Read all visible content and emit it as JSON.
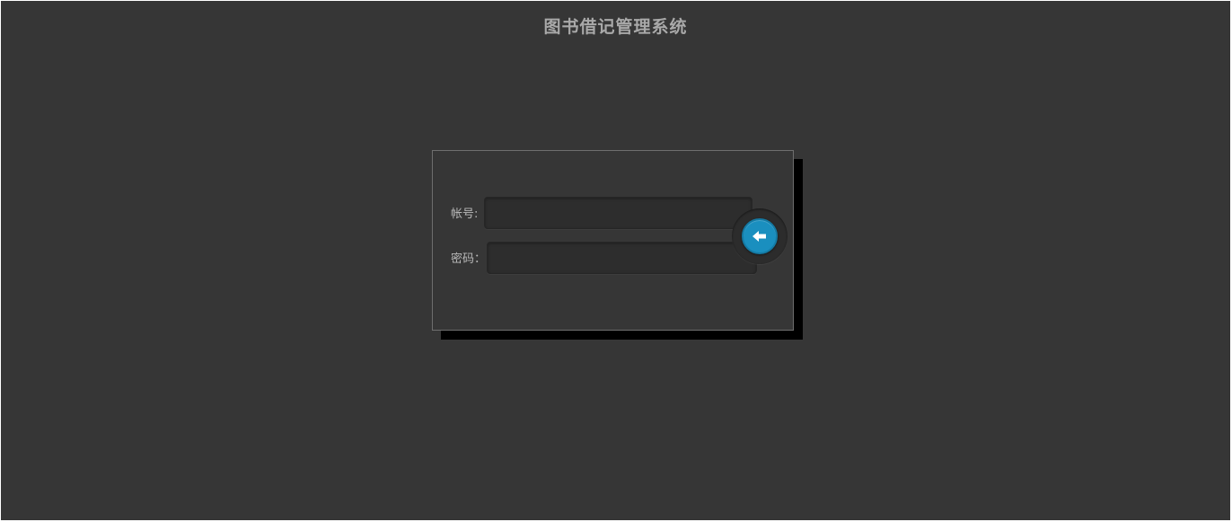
{
  "page": {
    "title": "图书借记管理系统"
  },
  "login": {
    "account_label": "帐号:",
    "account_value": "",
    "password_label": "密码：",
    "password_value": "",
    "submit_icon": "arrow-left-icon"
  },
  "colors": {
    "background": "#363636",
    "accent": "#1a8fbf"
  }
}
